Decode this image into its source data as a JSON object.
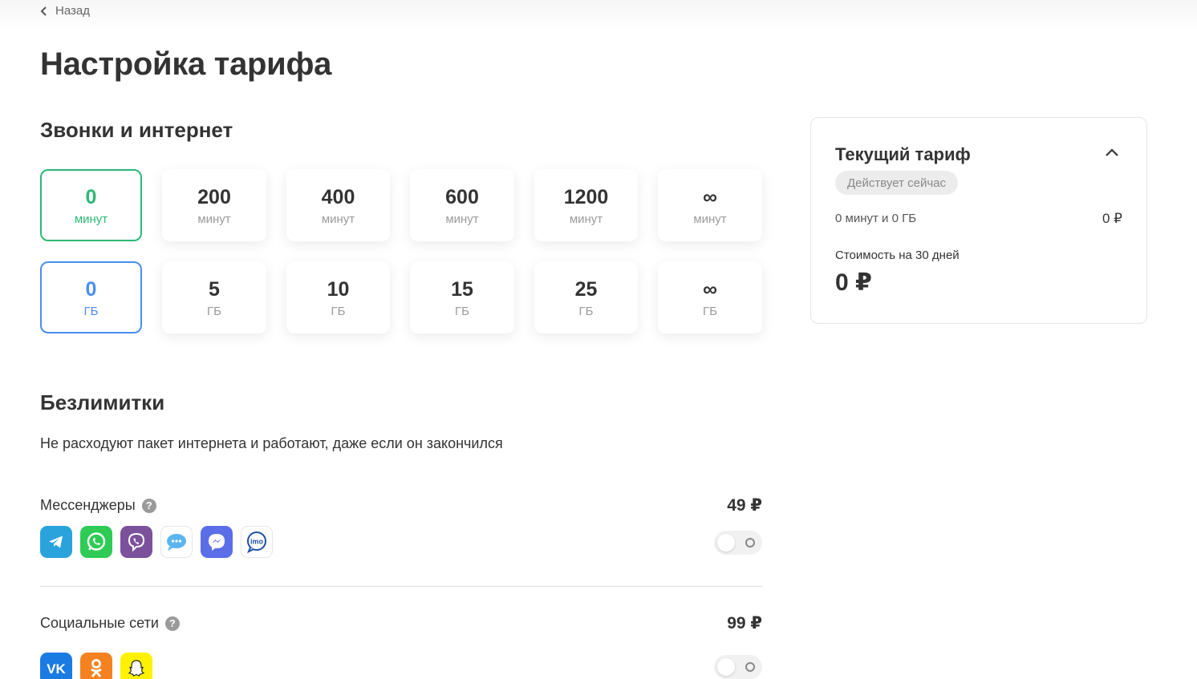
{
  "nav": {
    "back_label": "Назад"
  },
  "page": {
    "title": "Настройка тарифа"
  },
  "calls_internet": {
    "title": "Звонки и интернет",
    "minutes": [
      {
        "value": "0",
        "unit": "минут",
        "selected": true
      },
      {
        "value": "200",
        "unit": "минут"
      },
      {
        "value": "400",
        "unit": "минут"
      },
      {
        "value": "600",
        "unit": "минут"
      },
      {
        "value": "1200",
        "unit": "минут"
      },
      {
        "value": "∞",
        "unit": "минут"
      }
    ],
    "gigabytes": [
      {
        "value": "0",
        "unit": "ГБ",
        "selected": true
      },
      {
        "value": "5",
        "unit": "ГБ"
      },
      {
        "value": "10",
        "unit": "ГБ"
      },
      {
        "value": "15",
        "unit": "ГБ"
      },
      {
        "value": "25",
        "unit": "ГБ"
      },
      {
        "value": "∞",
        "unit": "ГБ"
      }
    ]
  },
  "unlimited": {
    "title": "Безлимитки",
    "description": "Не расходуют пакет интернета и работают, даже если он закончился",
    "options": [
      {
        "label": "Мессенджеры",
        "price": "49 ₽",
        "enabled": false,
        "apps": [
          "telegram-icon",
          "whatsapp-icon",
          "viber-icon",
          "imessage-icon",
          "messenger-icon",
          "imo-icon"
        ]
      },
      {
        "label": "Социальные сети",
        "price": "99 ₽",
        "enabled": false,
        "apps": [
          "vk-icon",
          "odnoklassniki-icon",
          "snapchat-icon"
        ]
      }
    ]
  },
  "current_tariff": {
    "title": "Текущий тариф",
    "status_badge": "Действует сейчас",
    "summary": "0 минут и 0 ГБ",
    "summary_price": "0 ₽",
    "cost_label": "Стоимость на 30 дней",
    "cost_value": "0 ₽"
  },
  "colors": {
    "green": "#2bb974",
    "blue": "#4a8ef0",
    "text": "#333333",
    "muted": "#9a9a9a"
  },
  "icons": {
    "help": "question-icon",
    "back": "chevron-left-icon",
    "collapse": "chevron-up-icon"
  }
}
